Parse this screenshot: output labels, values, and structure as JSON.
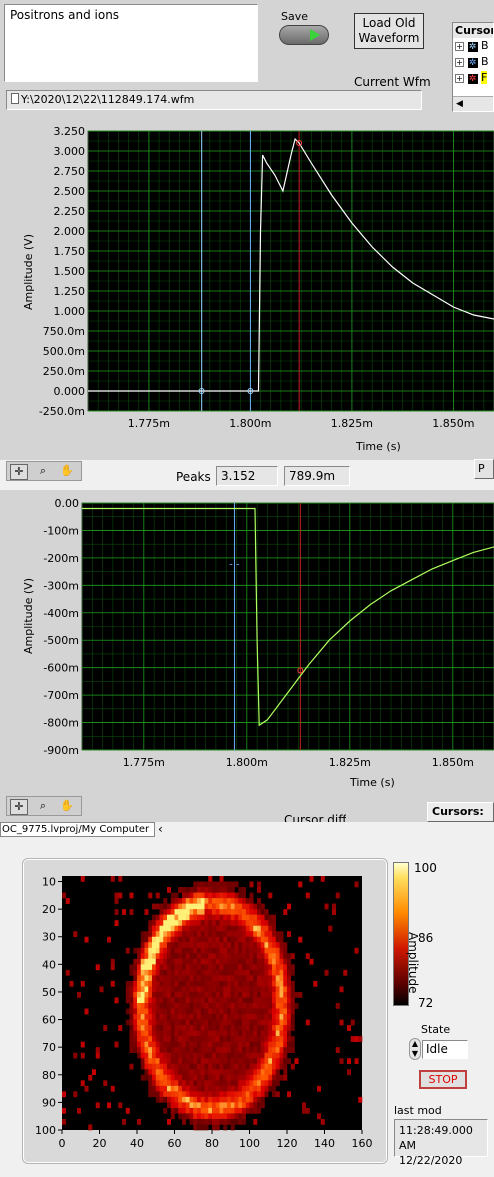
{
  "comment_box": {
    "text": "Positrons and ions"
  },
  "save": {
    "label": "Save"
  },
  "load_button": {
    "line1": "Load Old",
    "line2": "Waveform"
  },
  "current_wfm": {
    "label": "Current Wfm",
    "path": "Y:\\2020\\12\\22\\112849.174.wfm"
  },
  "cursors_legend": {
    "title": "Cursors",
    "items": [
      "B",
      "B",
      "F"
    ]
  },
  "graph1": {
    "x_ticks": [
      "1.775m",
      "1.800m",
      "1.825m",
      "1.850m"
    ],
    "y_ticks": [
      "3.250",
      "3.000",
      "2.750",
      "2.500",
      "2.250",
      "2.000",
      "1.750",
      "1.500",
      "1.250",
      "1.000",
      "750.0m",
      "500.0m",
      "250.0m",
      "0.000",
      "-250.0m"
    ],
    "xlabel": "Time (s)",
    "ylabel": "Amplitude (V)"
  },
  "peaks": {
    "label": "Peaks",
    "value1": "3.152",
    "value2": "789.9m"
  },
  "graph2": {
    "x_ticks": [
      "1.775m",
      "1.800m",
      "1.825m",
      "1.850m"
    ],
    "y_ticks": [
      "0.00",
      "-100m",
      "-200m",
      "-300m",
      "-400m",
      "-500m",
      "-600m",
      "-700m",
      "-800m",
      "-900m"
    ],
    "xlabel": "Time (s)",
    "ylabel": "Amplitude (V)"
  },
  "cursor_diff": {
    "label": "Cursor diff"
  },
  "cursors2": {
    "label": "Cursors:"
  },
  "project_tab": {
    "label": "OC_9775.lvproj/My Computer"
  },
  "heatmap": {
    "x_ticks": [
      "0",
      "20",
      "40",
      "60",
      "80",
      "100",
      "120",
      "140",
      "160"
    ],
    "y_ticks": [
      "10",
      "20",
      "30",
      "40",
      "50",
      "60",
      "70",
      "80",
      "90",
      "100"
    ],
    "scale_ticks": [
      "100",
      "86",
      "72"
    ],
    "scale_label": "Amplitude"
  },
  "state": {
    "label": "State",
    "value": "Idle"
  },
  "stop_button": {
    "label": "STOP"
  },
  "last_mod": {
    "label": "last mod",
    "time": "11:28:49.000 AM",
    "date": "12/22/2020"
  },
  "chart_data": [
    {
      "type": "line",
      "xlabel": "Time (s)",
      "ylabel": "Amplitude (V)",
      "xlim": [
        0.00176,
        0.00186
      ],
      "ylim": [
        -0.25,
        3.25
      ],
      "grid": true,
      "series": [
        {
          "color": "#ffffff",
          "x": [
            0.00176,
            0.00178,
            0.00179,
            0.0018,
            0.001802,
            0.0018025,
            0.001803,
            0.001804,
            0.001806,
            0.001808,
            0.00181,
            0.001811,
            0.001812,
            0.001815,
            0.00182,
            0.001825,
            0.00183,
            0.001835,
            0.00184,
            0.001845,
            0.00185,
            0.001855,
            0.00186
          ],
          "y": [
            0.0,
            0.0,
            0.0,
            0.0,
            0.0,
            2.0,
            2.95,
            2.85,
            2.7,
            2.5,
            2.95,
            3.15,
            3.1,
            2.85,
            2.45,
            2.1,
            1.8,
            1.55,
            1.35,
            1.2,
            1.05,
            0.95,
            0.9
          ]
        }
      ],
      "cursors": [
        {
          "x": 0.001788,
          "color": "#9fd8ff"
        },
        {
          "x": 0.0018,
          "color": "#6fb0ff"
        },
        {
          "x": 0.001812,
          "color": "#c02020"
        }
      ]
    },
    {
      "type": "line",
      "xlabel": "Time (s)",
      "ylabel": "Amplitude (V)",
      "xlim": [
        0.00176,
        0.00186
      ],
      "ylim": [
        -0.9,
        0.0
      ],
      "grid": true,
      "series": [
        {
          "color": "#b0ff60",
          "x": [
            0.00176,
            0.00179,
            0.0018,
            0.001802,
            0.0018025,
            0.001803,
            0.001805,
            0.00181,
            0.001815,
            0.00182,
            0.001825,
            0.00183,
            0.001835,
            0.00184,
            0.001845,
            0.00185,
            0.001855,
            0.00186
          ],
          "y": [
            -0.02,
            -0.02,
            -0.02,
            -0.02,
            -0.5,
            -0.81,
            -0.79,
            -0.69,
            -0.59,
            -0.5,
            -0.43,
            -0.37,
            -0.32,
            -0.28,
            -0.24,
            -0.21,
            -0.18,
            -0.16
          ]
        }
      ],
      "cursors": [
        {
          "x": 0.001797,
          "color": "#6fb0ff"
        },
        {
          "x": 0.001813,
          "color": "#c02020"
        }
      ]
    },
    {
      "type": "heatmap",
      "xlim": [
        0,
        160
      ],
      "ylim": [
        100,
        8
      ],
      "colorscale": "black-red-yellow",
      "zlim": [
        72,
        100
      ],
      "shape": "ring",
      "ring_center": [
        80,
        55
      ],
      "ring_radius": [
        40,
        40
      ]
    }
  ]
}
